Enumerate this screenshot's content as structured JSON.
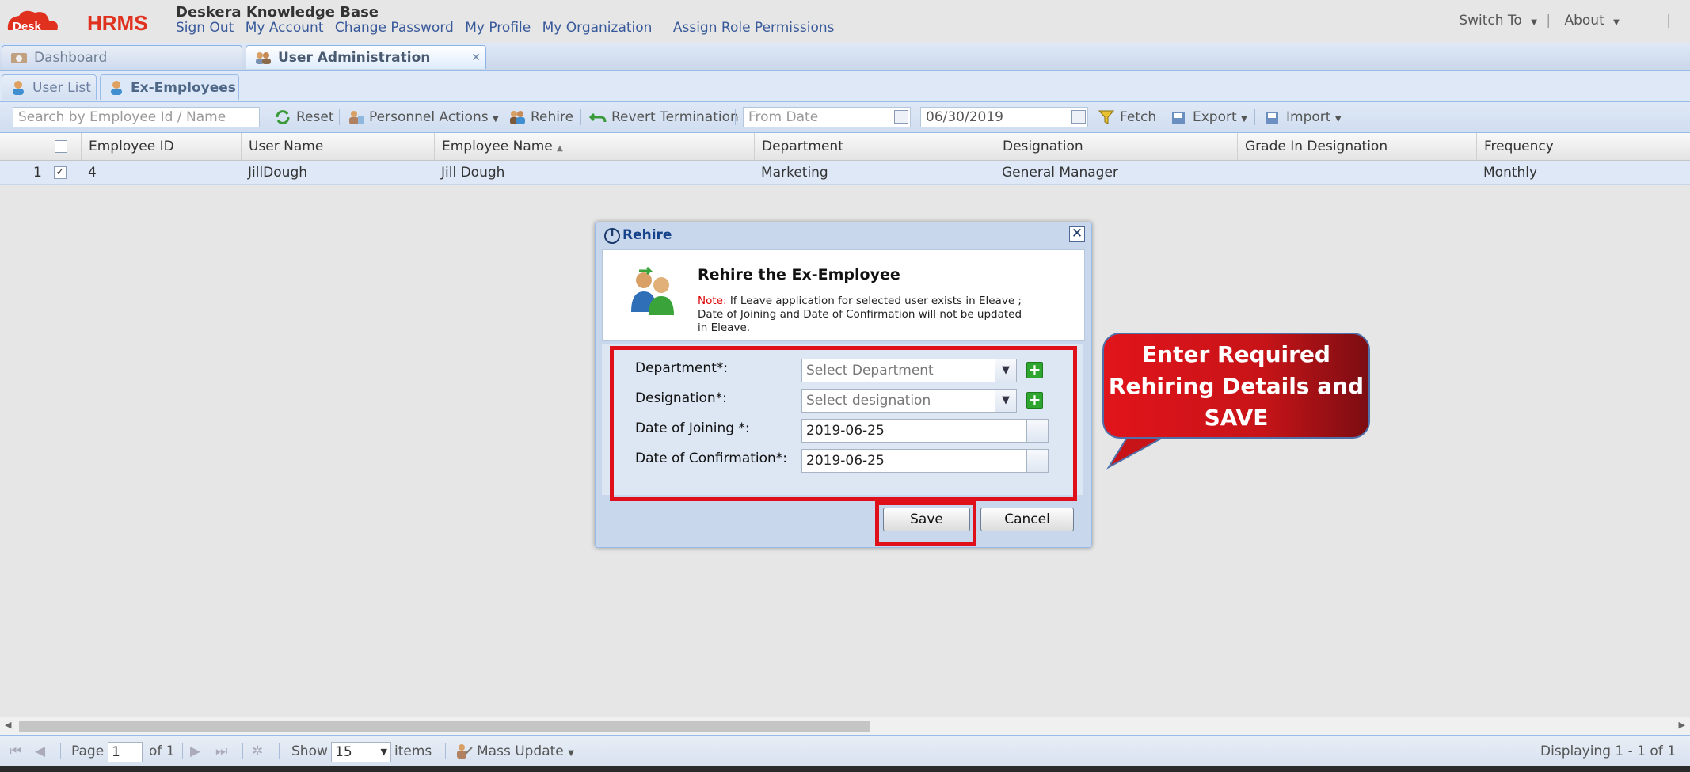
{
  "app": {
    "logo_text": "Deskera HRMS",
    "title": "Deskera Knowledge Base",
    "top_links": [
      "Sign Out",
      "My Account",
      "Change Password",
      "My Profile",
      "My Organization",
      "Assign Role Permissions"
    ],
    "switch_to": "Switch To",
    "about": "About",
    "accent_color": "#e0101a",
    "brand_color": "#15428b"
  },
  "tabs": {
    "dashboard": "Dashboard",
    "user_admin": "User Administration"
  },
  "subtabs": {
    "user_list": "User List",
    "ex_employees": "Ex-Employees"
  },
  "toolbar": {
    "search_placeholder": "Search by Employee Id / Name",
    "reset": "Reset",
    "personnel_actions": "Personnel Actions",
    "rehire": "Rehire",
    "revert_termination": "Revert Termination",
    "from_date_placeholder": "From Date",
    "to_date": "06/30/2019",
    "fetch": "Fetch",
    "export": "Export",
    "import": "Import"
  },
  "grid": {
    "columns": [
      "Employee ID",
      "User Name",
      "Employee Name",
      "Department",
      "Designation",
      "Grade In Designation",
      "Frequency"
    ],
    "rows": [
      {
        "num": "1",
        "employee_id": "4",
        "user_name": "JillDough",
        "employee_name": "Jill Dough",
        "department": "Marketing",
        "designation": "General Manager",
        "grade": "",
        "frequency": "Monthly",
        "checked": true
      }
    ]
  },
  "dialog": {
    "title": "Rehire",
    "heading": "Rehire the Ex-Employee",
    "note_label": "Note:",
    "note_text": "If Leave application for selected user exists in Eleave ; Date of Joining and Date of Confirmation will not be updated in Eleave.",
    "department_label": "Department*:",
    "department_placeholder": "Select Department",
    "designation_label": "Designation*:",
    "designation_placeholder": "Select designation",
    "doj_label": "Date of Joining *:",
    "doj_value": "2019-06-25",
    "doc_label": "Date of Confirmation*:",
    "doc_value": "2019-06-25",
    "save": "Save",
    "cancel": "Cancel"
  },
  "callout": {
    "text": "Enter Required Rehiring Details and SAVE"
  },
  "pager": {
    "page_label": "Page",
    "page_value": "1",
    "of_label": "of 1",
    "show_label": "Show",
    "show_value": "15",
    "items_label": "items",
    "mass_update": "Mass Update",
    "displaying": "Displaying 1 - 1 of 1"
  }
}
